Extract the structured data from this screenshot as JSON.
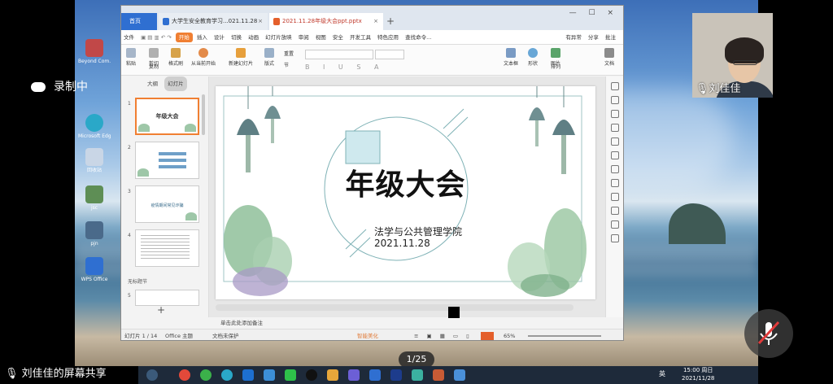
{
  "recording": {
    "label": "录制中"
  },
  "presenter": {
    "name": "刘佳佳",
    "share_label": "刘佳佳的屏幕共享"
  },
  "page_indicator": "1/25",
  "desktop_icons": [
    "Beyond Com.",
    "Microsoft Edge",
    "回收站",
    "jsc",
    "pjn",
    "WPS Office"
  ],
  "window": {
    "tabs": [
      {
        "label": "首页"
      },
      {
        "label": "大学生安全教育学习...021.11.28"
      },
      {
        "label": "2021.11.28年级大会ppt.pptx"
      }
    ],
    "menu": [
      "文件",
      "开始",
      "插入",
      "设计",
      "切换",
      "动画",
      "幻灯片放映",
      "审阅",
      "视图",
      "安全",
      "开发工具",
      "特色应用",
      "查找命令..."
    ],
    "menu_active": "开始",
    "menu_right": [
      "有异常",
      "分享",
      "批注"
    ],
    "ribbon": [
      "剪切",
      "粘贴",
      "复制",
      "格式刷",
      "从当前开始",
      "新建幻灯片",
      "版式",
      "节",
      "重置",
      "文本框",
      "形状",
      "图片",
      "排列",
      "文档"
    ],
    "panel_tabs": [
      "大纲",
      "幻灯片"
    ],
    "thumb_titles": [
      "年级大会",
      "",
      "疫情期间常见诈骗",
      ""
    ],
    "section_label": "无标题节",
    "notes_placeholder": "单击此处添加备注",
    "status": {
      "slide": "幻灯片 1 / 14",
      "theme": "Office 主题",
      "protect": "文档未保护",
      "smart": "智能美化",
      "zoom": "65%"
    }
  },
  "slide": {
    "title": "年级大会",
    "subtitle": "法学与公共管理学院",
    "date": "2021.11.28"
  },
  "taskbar": {
    "time": "15:00 周日",
    "date": "2021/11/28",
    "lang": "英"
  },
  "colors": {
    "accent": "#f07f32",
    "wps_blue": "#2f6fd1"
  }
}
